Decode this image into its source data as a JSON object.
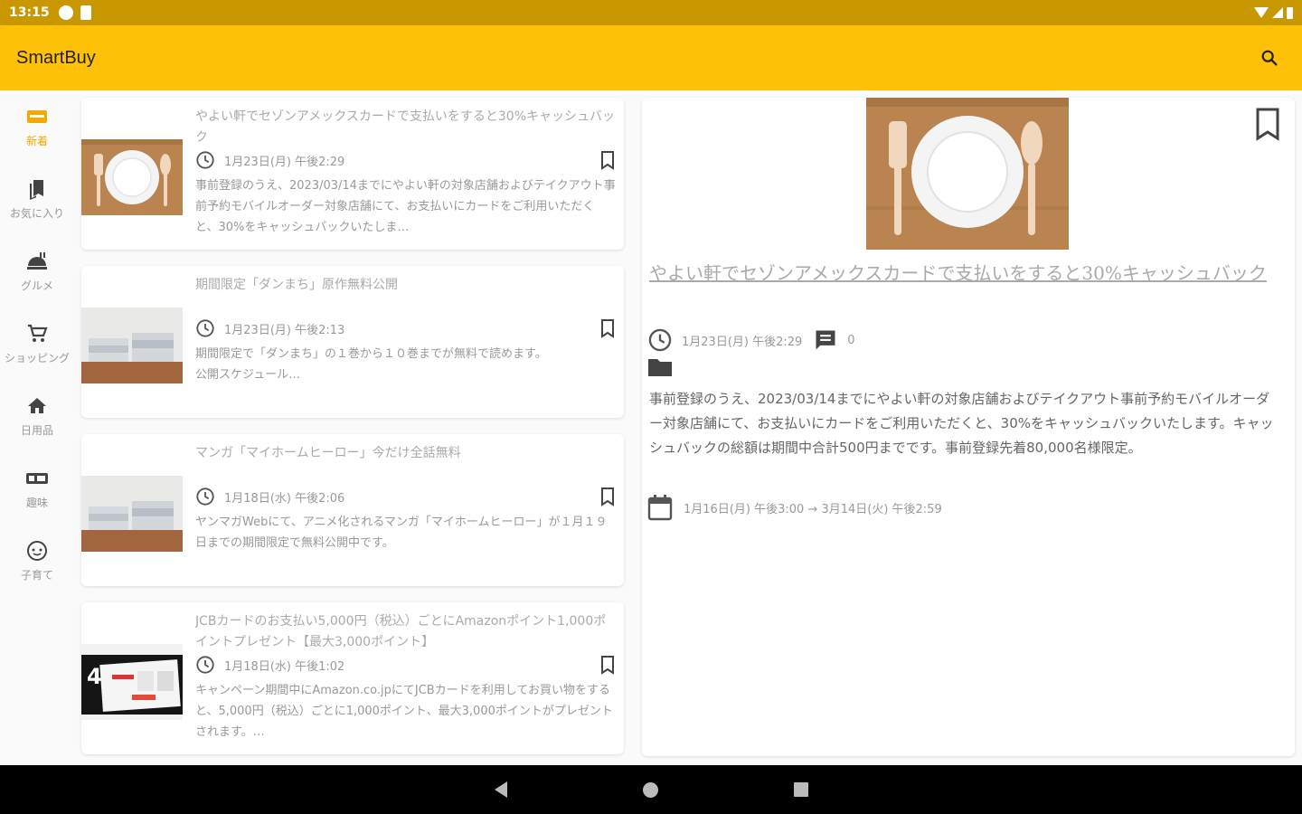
{
  "status_bar": {
    "time": "13:15"
  },
  "app_bar": {
    "title": "SmartBuy",
    "search_icon": "search-icon"
  },
  "accent_color": "#ffc107",
  "status_color": "#c99700",
  "nav_rail": [
    {
      "label": "新着",
      "icon": "new-badge-icon",
      "active": true
    },
    {
      "label": "お気に入り",
      "icon": "bookmarks-icon",
      "active": false
    },
    {
      "label": "グルメ",
      "icon": "restaurant-icon",
      "active": false
    },
    {
      "label": "ショッピング",
      "icon": "cart-icon",
      "active": false
    },
    {
      "label": "日用品",
      "icon": "home-icon",
      "active": false
    },
    {
      "label": "趣味",
      "icon": "ticket-icon",
      "active": false
    },
    {
      "label": "子育て",
      "icon": "child-icon",
      "active": false
    }
  ],
  "articles": [
    {
      "title": "やよい軒でセゾンアメックスカードで支払いをすると30%キャッシュバック",
      "date": "1月23日(月) 午後2:29",
      "description": "事前登録のうえ、2023/03/14までにやよい軒の対象店舗およびテイクアウト事前予約モバイルオーダー対象店舗にて、お支払いにカードをご利用いただくと、30%をキャッシュバックいたしま…",
      "thumb": "plate"
    },
    {
      "title": "期間限定「ダンまち」原作無料公開",
      "date": "1月23日(月) 午後2:13",
      "description": "期間限定で「ダンまち」の１巻から１０巻までが無料で読めます。\n公開スケジュール…",
      "thumb": "books"
    },
    {
      "title": "マンガ「マイホームヒーロー」今だけ全話無料",
      "date": "1月18日(水) 午後2:06",
      "description": "ヤンマガWebにて、アニメ化されるマンガ「マイホームヒーロー」が１月１９日までの期間限定で無料公開中です。",
      "thumb": "books"
    },
    {
      "title": "JCBカードのお支払い5,000円（税込）ごとにAmazonポイント1,000ポイントプレゼント【最大3,000ポイント】",
      "date": "1月18日(水) 午後1:02",
      "description": "キャンペーン期間中にAmazon.co.jpにてJCBカードを利用してお買い物をすると、5,000円（税込）ごとに1,000ポイント、最大3,000ポイントがプレゼントされます。…",
      "thumb": "card"
    }
  ],
  "detail": {
    "title": "やよい軒でセゾンアメックスカードで支払いをすると30%キャッシュバック",
    "date": "1月23日(月) 午後2:29",
    "comment_count": "0",
    "description": "事前登録のうえ、2023/03/14までにやよい軒の対象店舗およびテイクアウト事前予約モバイルオーダー対象店舗にて、お支払いにカードをご利用いただくと、30%をキャッシュバックいたします。キャッシュバックの総額は期間中合計500円までです。事前登録先着80,000名様限定。",
    "period": "1月16日(月) 午後3:00 → 3月14日(火) 午後2:59"
  }
}
